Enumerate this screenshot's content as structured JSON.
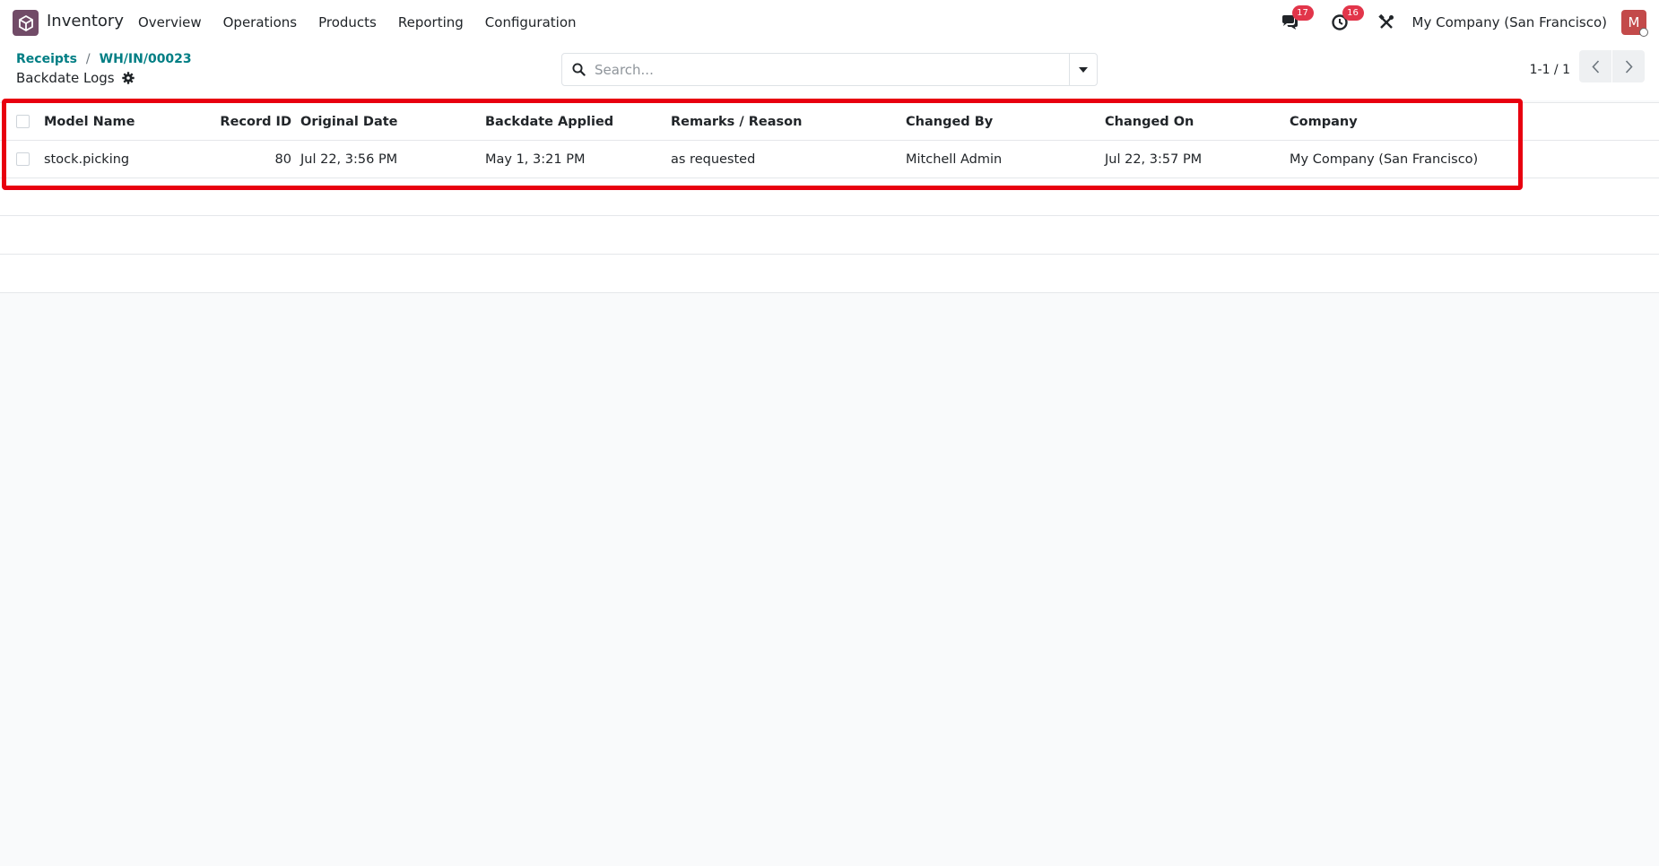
{
  "app": {
    "name": "Inventory",
    "brand_color": "#714b67"
  },
  "menu": [
    {
      "label": "Overview"
    },
    {
      "label": "Operations"
    },
    {
      "label": "Products"
    },
    {
      "label": "Reporting"
    },
    {
      "label": "Configuration"
    }
  ],
  "systray": {
    "messages_count": "17",
    "activities_count": "16",
    "company": "My Company (San Francisco)",
    "avatar_initial": "M"
  },
  "breadcrumb": [
    {
      "label": "Receipts"
    },
    {
      "label": "WH/IN/00023"
    }
  ],
  "breadcrumb_separator": "/",
  "view_title": "Backdate Logs",
  "search": {
    "placeholder": "Search...",
    "value": ""
  },
  "pager": {
    "value": "1-1 / 1"
  },
  "table": {
    "columns": [
      "Model Name",
      "Record ID",
      "Original Date",
      "Backdate Applied",
      "Remarks / Reason",
      "Changed By",
      "Changed On",
      "Company"
    ],
    "rows": [
      [
        "stock.picking",
        "80",
        "Jul 22, 3:56 PM",
        "May 1, 3:21 PM",
        "as requested",
        "Mitchell Admin",
        "Jul 22, 3:57 PM",
        "My Company (San Francisco)"
      ]
    ]
  },
  "colors": {
    "link": "#017e84",
    "badge": "#e2354a",
    "highlight": "#e8000f",
    "avatar": "#c34a4a"
  }
}
